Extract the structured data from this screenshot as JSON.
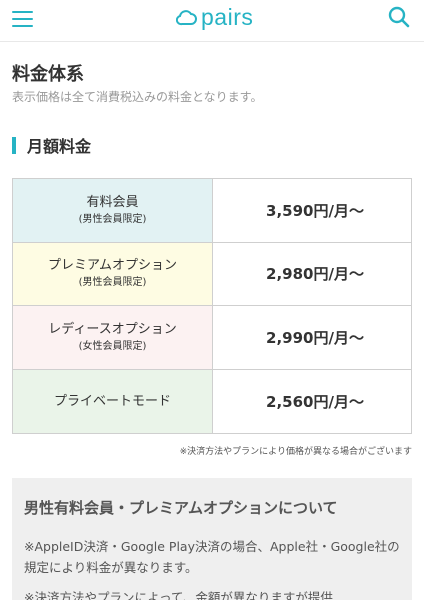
{
  "header": {
    "logo_text": "pairs",
    "menu_icon": "hamburger-menu-icon",
    "search_icon": "search-icon",
    "accent_color": "#26b3c4"
  },
  "page": {
    "title": "料金体系",
    "subtitle": "表示価格は全て消費税込みの料金となります。"
  },
  "monthly": {
    "heading": "月額料金",
    "plans": [
      {
        "name": "有料会員",
        "note": "(男性会員限定)",
        "price": "3,590円/月〜",
        "bg": "#e2f2f3"
      },
      {
        "name": "プレミアムオプション",
        "note": "(男性会員限定)",
        "price": "2,980円/月〜",
        "bg": "#fefce3"
      },
      {
        "name": "レディースオプション",
        "note": "(女性会員限定)",
        "price": "2,990円/月〜",
        "bg": "#fcf2f2"
      },
      {
        "name": "プライベートモード",
        "note": "",
        "price": "2,560円/月〜",
        "bg": "#eaf4e9"
      }
    ],
    "footnote": "※決済方法やプランにより価格が異なる場合がございます"
  },
  "info": {
    "title": "男性有料会員・プレミアムオプションについて",
    "text1": "※AppleID決済・Google Play決済の場合、Apple社・Google社の規定により料金が異なります。",
    "text2": "※決済方法やプランによって、金額が異なりますが提供"
  }
}
